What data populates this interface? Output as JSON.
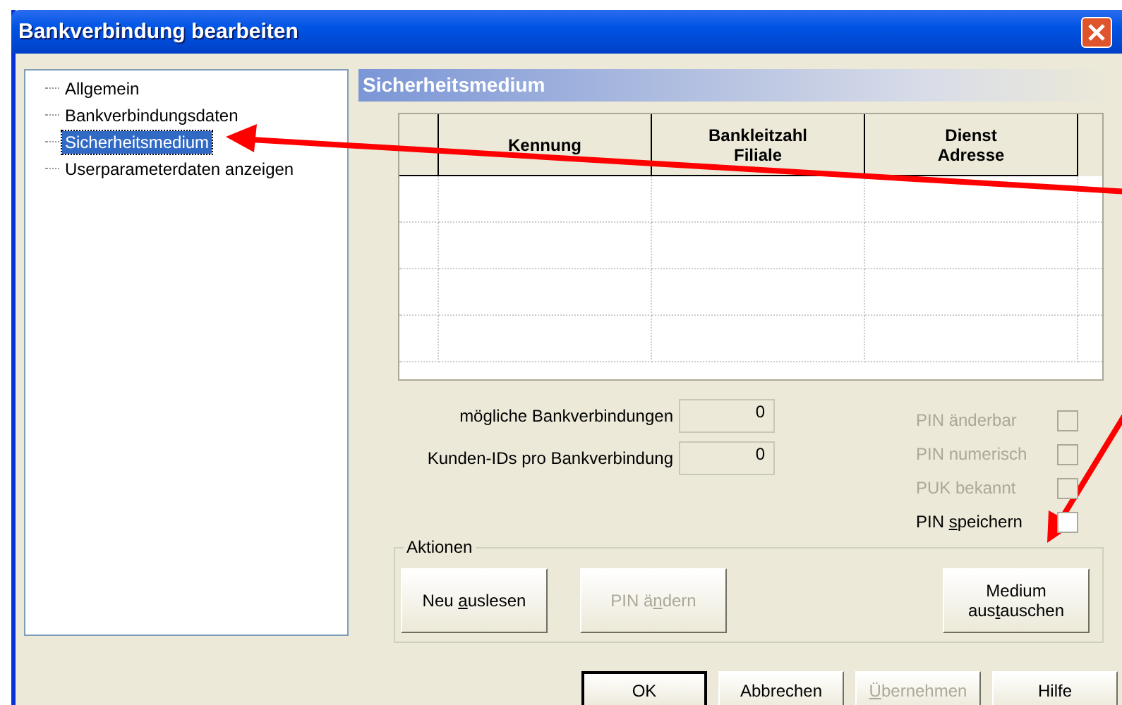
{
  "window": {
    "title": "Bankverbindung bearbeiten"
  },
  "tree": {
    "items": [
      {
        "label": "Allgemein",
        "selected": false
      },
      {
        "label": "Bankverbindungsdaten",
        "selected": false
      },
      {
        "label": "Sicherheitsmedium",
        "selected": true
      },
      {
        "label": "Userparameterdaten anzeigen",
        "selected": false
      }
    ]
  },
  "panel": {
    "title": "Sicherheitsmedium",
    "table": {
      "columns": [
        {
          "lines": [
            "Kennung"
          ]
        },
        {
          "lines": [
            "Bankleitzahl",
            "Filiale"
          ]
        },
        {
          "lines": [
            "Dienst",
            "Adresse"
          ]
        }
      ]
    },
    "fields": [
      {
        "label": "mögliche Bankverbindungen",
        "value": "0"
      },
      {
        "label": "Kunden-IDs pro Bankverbindung",
        "value": "0"
      }
    ],
    "checkboxes": [
      {
        "label": "PIN änderbar",
        "checked": false,
        "disabled": true
      },
      {
        "label": "PIN numerisch",
        "checked": false,
        "disabled": true
      },
      {
        "label": "PUK bekannt",
        "checked": false,
        "disabled": true
      },
      {
        "label": {
          "pre": "PIN ",
          "key": "s",
          "post": "peichern"
        },
        "checked": false,
        "disabled": false
      }
    ],
    "actions": {
      "title": "Aktionen",
      "buttons": [
        {
          "lines": [
            {
              "pre": "Neu ",
              "key": "a",
              "post": "uslesen"
            }
          ],
          "disabled": false
        },
        {
          "lines": [
            {
              "pre": "PIN ä",
              "key": "n",
              "post": "dern"
            }
          ],
          "disabled": true
        },
        {
          "lines": [
            "Medium",
            {
              "pre": "aus",
              "key": "t",
              "post": "auschen"
            }
          ],
          "disabled": false
        }
      ]
    }
  },
  "buttons": [
    {
      "label": "OK",
      "disabled": false,
      "default": true
    },
    {
      "label": "Abbrechen",
      "disabled": false,
      "default": false
    },
    {
      "label": {
        "key": "Ü",
        "post": "bernehmen"
      },
      "disabled": true,
      "default": false
    },
    {
      "label": "Hilfe",
      "disabled": false,
      "default": false
    }
  ]
}
